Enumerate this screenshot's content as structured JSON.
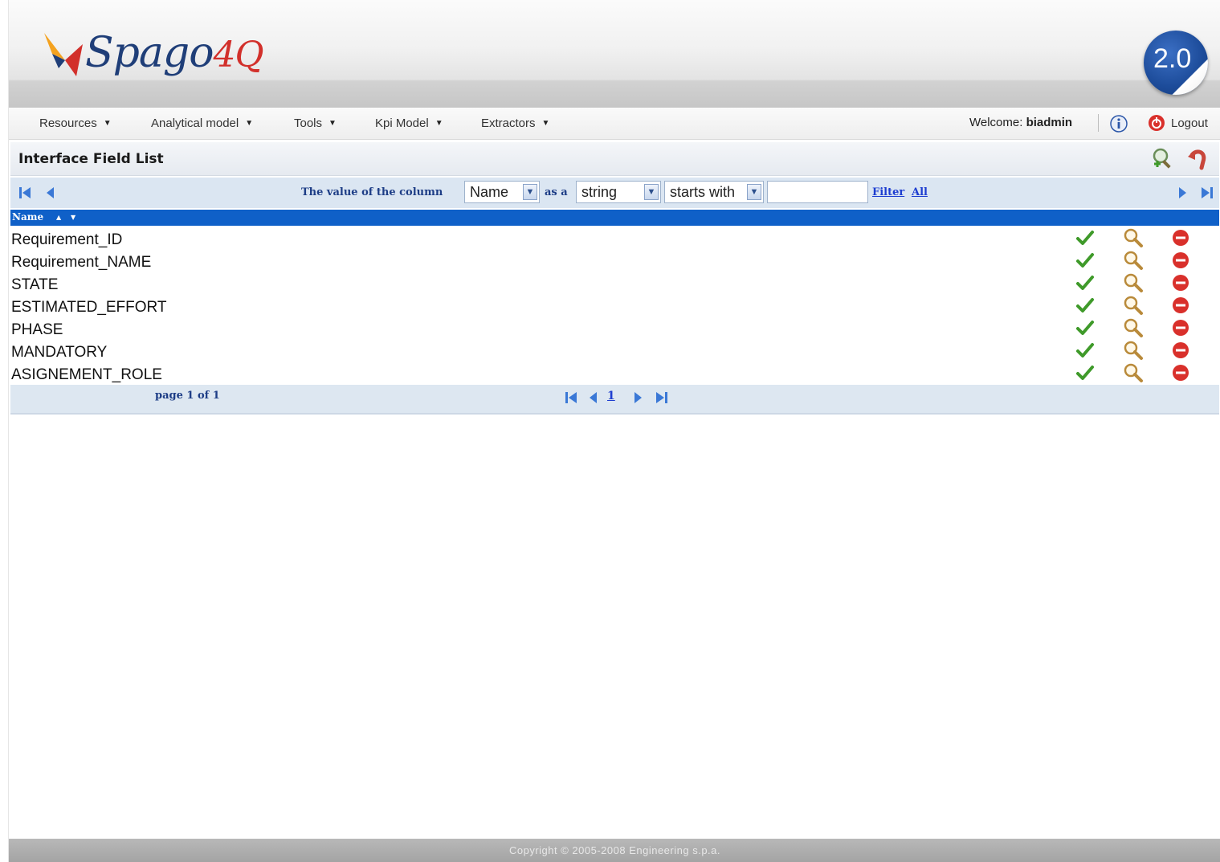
{
  "brand": {
    "wordmark": "Spago",
    "suffix": "4Q",
    "version": "2.0"
  },
  "menu": {
    "items": [
      {
        "label": "Resources"
      },
      {
        "label": "Analytical model"
      },
      {
        "label": "Tools"
      },
      {
        "label": "Kpi Model"
      },
      {
        "label": "Extractors"
      }
    ],
    "welcome_prefix": "Welcome:",
    "username": "biadmin",
    "logout_label": "Logout"
  },
  "page": {
    "title": "Interface Field List"
  },
  "filter": {
    "label_column": "The value of the column",
    "column_value": "Name",
    "label_as": "as a",
    "type_value": "string",
    "operator_value": "starts with",
    "input_value": "",
    "filter_link": "Filter",
    "all_link": "All"
  },
  "table": {
    "column_header": "Name",
    "rows": [
      {
        "name": "Requirement_ID"
      },
      {
        "name": "Requirement_NAME"
      },
      {
        "name": "STATE"
      },
      {
        "name": "ESTIMATED_EFFORT"
      },
      {
        "name": "PHASE"
      },
      {
        "name": "MANDATORY"
      },
      {
        "name": "ASIGNEMENT_ROLE"
      }
    ]
  },
  "pager": {
    "page_info": "page 1 of 1",
    "current_page": "1"
  },
  "footer": {
    "copyright": "Copyright © 2005-2008 Engineering s.p.a."
  },
  "colors": {
    "accent": "#0f60c8",
    "label_blue": "#1d3d86",
    "link_blue": "#1d3dd0",
    "check_green": "#3f9a2a",
    "delete_red": "#d9302b"
  }
}
